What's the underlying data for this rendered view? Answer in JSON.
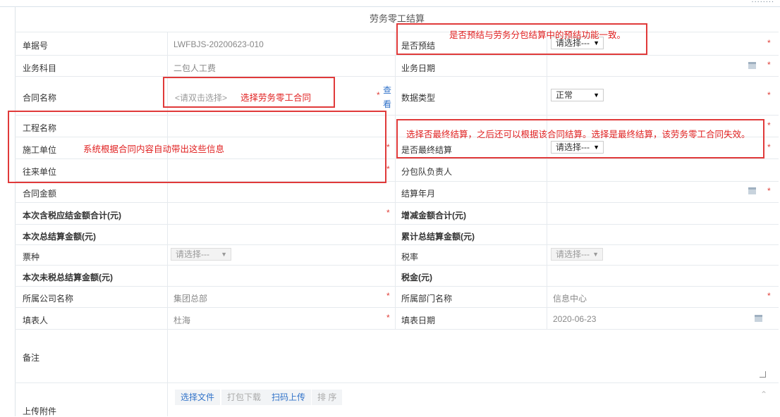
{
  "breadcrumb": "........",
  "form": {
    "title": "劳务零工结算",
    "doc_no": {
      "label": "单据号",
      "value": "LWFBJS-20200623-010"
    },
    "is_prepay": {
      "label": "是否预结",
      "value": "请选择---"
    },
    "subject": {
      "label": "业务科目",
      "value": "二包人工费"
    },
    "biz_date": {
      "label": "业务日期",
      "value": ""
    },
    "contract": {
      "label": "合同名称",
      "placeholder": "<请双击选择>",
      "view_link": "查看"
    },
    "data_type": {
      "label": "数据类型",
      "value": "正常"
    },
    "project": {
      "label": "工程名称"
    },
    "builder": {
      "label": "施工单位"
    },
    "is_final": {
      "label": "是否最终结算",
      "value": "请选择---"
    },
    "partner": {
      "label": "往来单位"
    },
    "team_lead": {
      "label": "分包队负责人"
    },
    "contract_amount": {
      "label": "合同金额"
    },
    "settle_month": {
      "label": "结算年月"
    },
    "tax_incl_total": {
      "label": "本次含税应结金额合计(元)"
    },
    "delta_total": {
      "label": "增减金额合计(元)"
    },
    "settle_total": {
      "label": "本次总结算金额(元)"
    },
    "cum_total": {
      "label": "累计总结算金额(元)"
    },
    "invoice_type": {
      "label": "票种",
      "value": "请选择---"
    },
    "tax_rate": {
      "label": "税率",
      "value": "请选择---"
    },
    "pre_tax_total": {
      "label": "本次未税总结算金额(元)"
    },
    "tax": {
      "label": "税金(元)"
    },
    "company": {
      "label": "所属公司名称",
      "value": "集团总部"
    },
    "dept": {
      "label": "所属部门名称",
      "value": "信息中心"
    },
    "filler": {
      "label": "填表人",
      "value": "杜海"
    },
    "fill_date": {
      "label": "填表日期",
      "value": "2020-06-23"
    },
    "remark": {
      "label": "备注"
    },
    "attachment": {
      "label": "上传附件",
      "buttons": [
        "选择文件",
        "打包下载",
        "扫码上传",
        "排 序"
      ]
    }
  },
  "annotations": {
    "prepay": "是否预结与劳务分包结算中的预结功能一致。",
    "contract": "选择劳务零工合同",
    "auto_fill": "系统根据合同内容自动带出这些信息",
    "final": "选择否最终结算，之后还可以根据该合同结算。选择是最终结算，该劳务零工合同失效。"
  },
  "required_mark": "*",
  "colors": {
    "required": "#e0403a",
    "annotation": "#e02020",
    "link": "#3072c9"
  }
}
